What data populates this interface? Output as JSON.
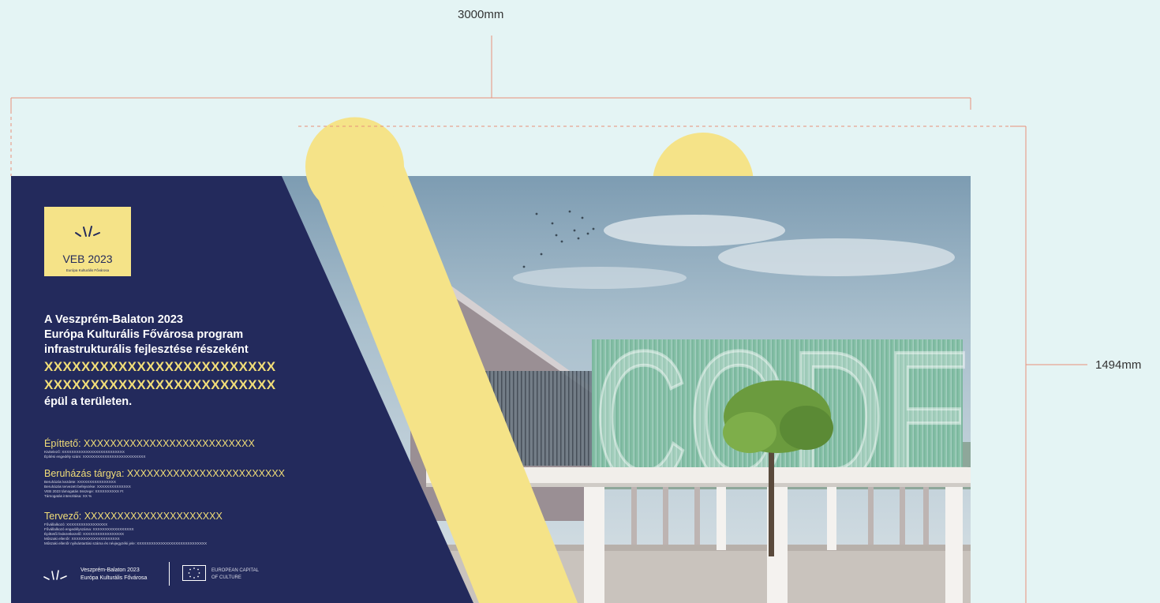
{
  "dimensions": {
    "width_label": "3000mm",
    "height_label": "1494mm"
  },
  "colors": {
    "background": "#e4f4f4",
    "navy": "#232a5c",
    "yellow": "#f5e388",
    "dimension_line": "#e8917a",
    "placeholder_text": "#f2de78"
  },
  "logo": {
    "icon": "veb-sunburst-icon",
    "title": "VEB 2023",
    "subtitle": "Európa Kulturális Fővárosa"
  },
  "intro": {
    "line1": "A Veszprém-Balaton 2023",
    "line2": "Európa Kulturális Fővárosa program",
    "line3": "infrastrukturális fejlesztése részeként",
    "placeholder1": "XXXXXXXXXXXXXXXXXXXXXXXXX",
    "placeholder2": "XXXXXXXXXXXXXXXXXXXXXXXXX",
    "closing": "épül a területen."
  },
  "sections": [
    {
      "title": "Építtető: XXXXXXXXXXXXXXXXXXXXXXXXXX",
      "lines": [
        "Kivitelező: XXXXXXXXXXXXXXXXXXXXXXXXXX",
        "Építési engedély szám: XXXXXXXXXXXXXXXXXXXXXXXXXX"
      ]
    },
    {
      "title": "Beruházás tárgya: XXXXXXXXXXXXXXXXXXXXXXXX",
      "lines": [
        "Beruházás kezdete: XXXXXXXXXXXXXXXX",
        "Beruházás tervezett befejezése: XXXXXXXXXXXXXX",
        "VEB 2023 támogatás összege: XXXXXXXXXX Ft",
        "Támogatás intenzitása: XX %"
      ]
    },
    {
      "title": "Tervező: XXXXXXXXXXXXXXXXXXXXX",
      "lines": [
        "Fővállalkozó: XXXXXXXXXXXXXXXXX",
        "Fővállalkozó engedélyszáma: XXXXXXXXXXXXXXXXX",
        "Építtetői fedezetkezelő: XXXXXXXXXXXXXXXXX",
        "Műszaki ellenőr: XXXXXXXXXXXXXXXXXXXX",
        "Műszaki ellenőr nyilvántartási száma és névjegyzéki jele: XXXXXXXXXXXXXXXXXXXXXXXXXXXXX"
      ]
    }
  ],
  "footer": {
    "veb_line1": "Veszprém-Balaton 2023",
    "veb_line2": "Európa Kulturális Fővárosa",
    "ecoc_line1": "EUROPEAN CAPITAL",
    "ecoc_line2": "OF CULTURE",
    "veb_icon": "veb-sunburst-icon",
    "ecoc_icon": "eu-stars-flag-icon"
  },
  "render_text": {
    "facade_letters": "CODE"
  }
}
